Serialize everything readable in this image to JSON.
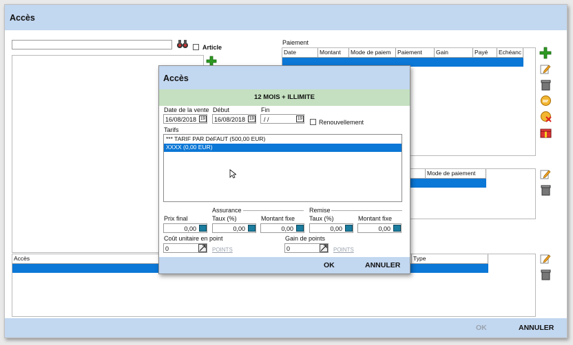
{
  "window": {
    "title": "Accès",
    "ok_label": "OK",
    "cancel_label": "ANNULER"
  },
  "left": {
    "article_label": "Article",
    "search_value": ""
  },
  "payment": {
    "title": "Paiement",
    "columns": [
      "Date",
      "Montant",
      "Mode de paiem",
      "Paiement",
      "Gain",
      "Payé",
      "Echéanc"
    ]
  },
  "payment2": {
    "columns": [
      "Mode de paiement"
    ]
  },
  "access_table": {
    "columns": [
      "Accès",
      "Type"
    ]
  },
  "dialog": {
    "title": "Accès",
    "product": "12 MOIS + ILLIMITE",
    "date_vente_label": "Date de la vente",
    "date_vente": "16/08/2018",
    "debut_label": "Début",
    "debut": "16/08/2018",
    "fin_label": "Fin",
    "fin": " / /",
    "renew_label": "Renouvellement",
    "tarifs_label": "Tarifs",
    "tarifs": [
      "*** TARIF PAR DéFAUT (500,00 EUR)",
      "XXXX (0,00 EUR)"
    ],
    "selected_tarif_index": 1,
    "assurance_label": "Assurance",
    "remise_label": "Remise",
    "prix_final_label": "Prix final",
    "prix_final": "0,00",
    "taux_label": "Taux (%)",
    "assurance_taux": "0,00",
    "montant_fixe_label": "Montant fixe",
    "assurance_montant": "0,00",
    "remise_taux": "0,00",
    "remise_montant": "0,00",
    "cout_label": "Coût unitaire en point",
    "cout_value": "0",
    "gain_label": "Gain de points",
    "gain_value": "0",
    "points_label": "POINTS",
    "ok_label": "OK",
    "cancel_label": "ANNULER"
  },
  "colors": {
    "header": "#c2d7f0",
    "selection": "#0b77d6",
    "product_band": "#c4e0c0"
  }
}
